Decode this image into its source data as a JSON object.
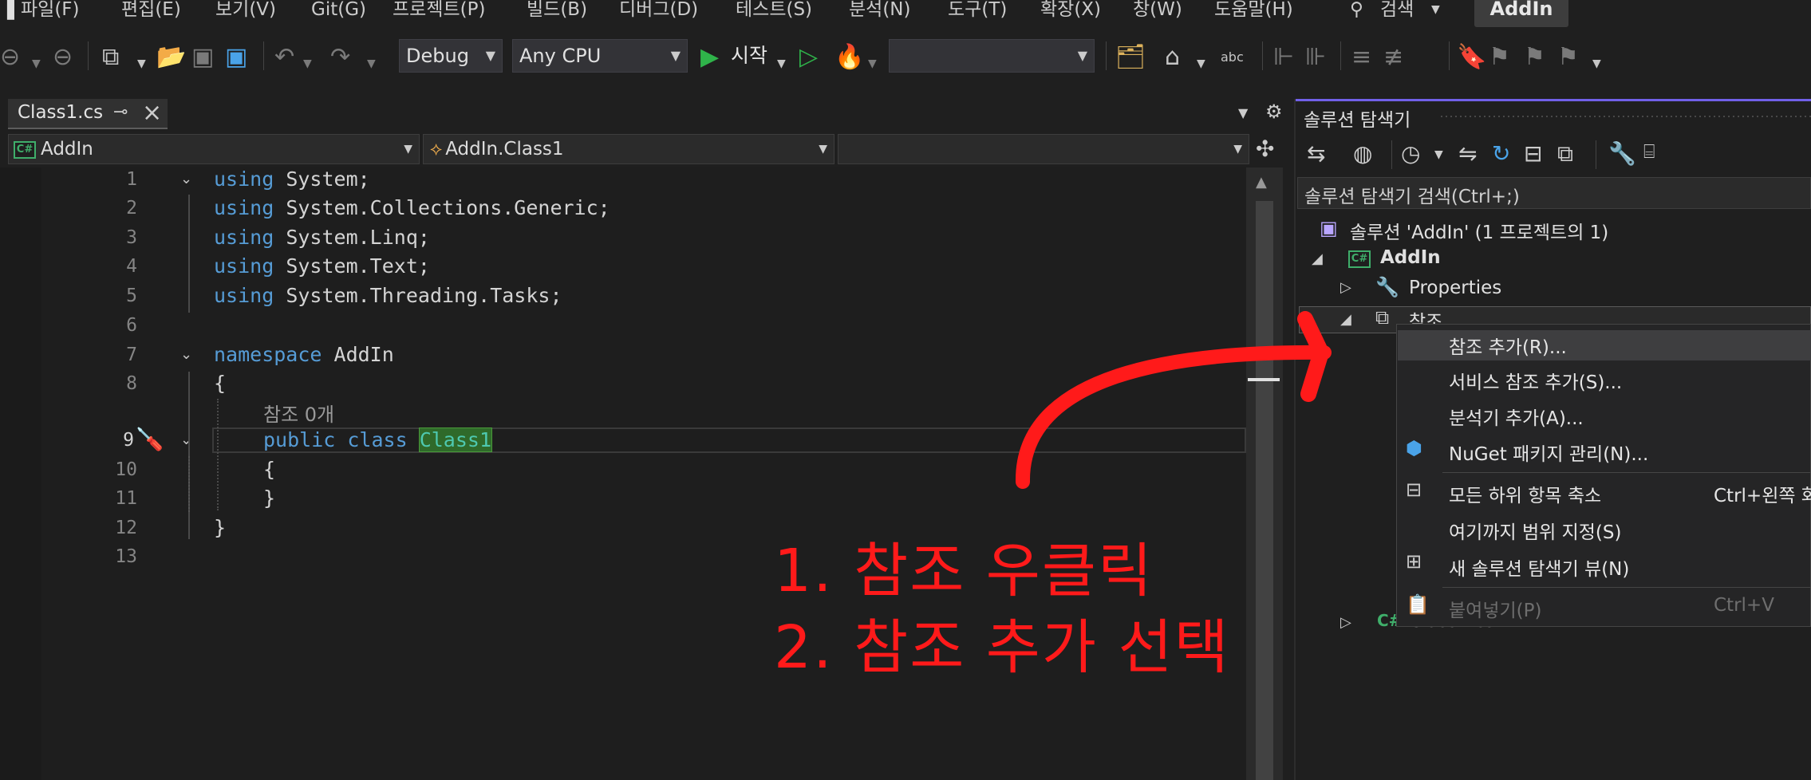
{
  "menu": [
    "파일(F)",
    "편집(E)",
    "보기(V)",
    "Git(G)",
    "프로젝트(P)",
    "빌드(B)",
    "디버그(D)",
    "테스트(S)",
    "분석(N)",
    "도구(T)",
    "확장(X)",
    "창(W)",
    "도움말(H)"
  ],
  "search_label": "검색",
  "app_name": "AddIn",
  "toolbar": {
    "config": "Debug",
    "platform": "Any CPU",
    "start_label": "시작"
  },
  "doc_tab": {
    "title": "Class1.cs"
  },
  "navbar": {
    "project": "AddIn",
    "type": "AddIn.Class1",
    "member": ""
  },
  "code": {
    "line_numbers": [
      "1",
      "2",
      "3",
      "4",
      "5",
      "6",
      "7",
      "8",
      "9",
      "10",
      "11",
      "12",
      "13"
    ],
    "using_kw": "using",
    "usings": [
      "System;",
      "System.Collections.Generic;",
      "System.Linq;",
      "System.Text;",
      "System.Threading.Tasks;"
    ],
    "namespace_kw": "namespace",
    "namespace_name": "AddIn",
    "open_brace": "{",
    "close_brace": "}",
    "ref_hint": "참조 0개",
    "public_kw": "public",
    "class_kw": "class",
    "class_name": "Class1"
  },
  "solution_explorer": {
    "title": "솔루션 탐색기",
    "search_placeholder": "솔루션 탐색기 검색(Ctrl+;)",
    "solution": "솔루션 'AddIn' (1 프로젝트의 1)",
    "project": "AddIn",
    "properties": "Properties",
    "references": "참조",
    "class_file": "Class1.cs"
  },
  "context_menu": {
    "items": [
      "참조 추가(R)...",
      "서비스 참조 추가(S)...",
      "분석기 추가(A)...",
      "NuGet 패키지 관리(N)...",
      "모든 하위 항목 축소",
      "여기까지 범위 지정(S)",
      "새 솔루션 탐색기 뷰(N)",
      "붙여넣기(P)"
    ],
    "collapse_shortcut": "Ctrl+왼쪽 화",
    "paste_shortcut": "Ctrl+V"
  },
  "annotation": {
    "line1": "1. 참조 우클릭",
    "line2": "2. 참조 추가 선택",
    "color": "#ff1a1a"
  }
}
